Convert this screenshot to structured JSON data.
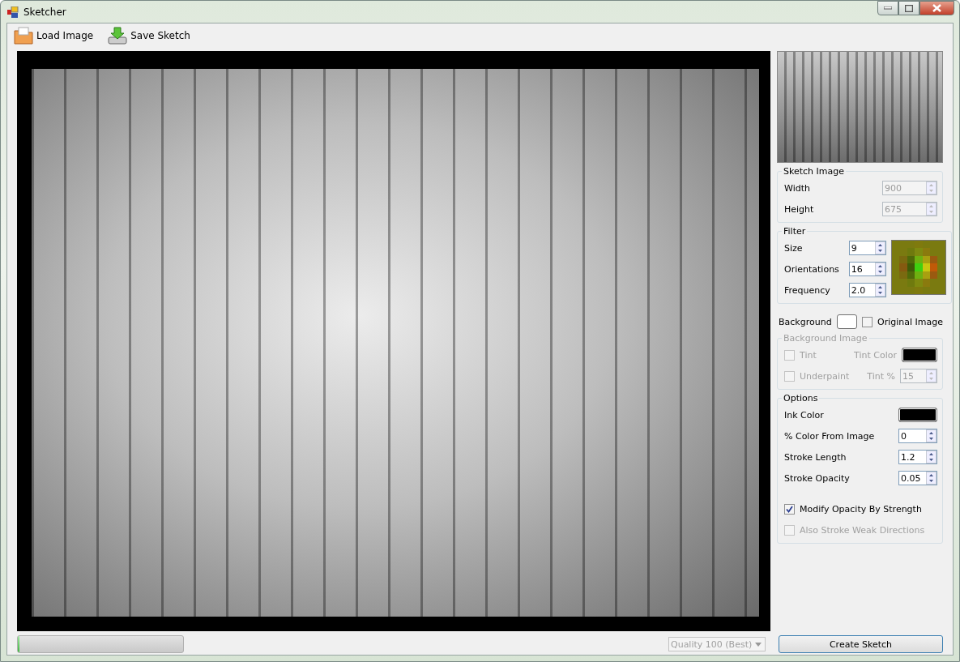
{
  "window": {
    "title": "Sketcher"
  },
  "toolbar": [
    {
      "label": "Load Image",
      "kind": "folder"
    },
    {
      "label": "Save Sketch",
      "kind": "save"
    }
  ],
  "sketch_image": {
    "title": "Sketch Image",
    "fields": [
      {
        "label": "Width",
        "value": "900",
        "disabled": true
      },
      {
        "label": "Height",
        "value": "675",
        "disabled": true
      }
    ]
  },
  "filter": {
    "title": "Filter",
    "fields": [
      {
        "label": "Size",
        "value": "9",
        "disabled": false
      },
      {
        "label": "Orientations",
        "value": "16",
        "disabled": false
      },
      {
        "label": "Frequency",
        "value": "2.0",
        "disabled": false
      }
    ]
  },
  "background": {
    "label": "Background",
    "color": "#ffffff",
    "original_image": {
      "label": "Original Image",
      "checked": false
    }
  },
  "background_image": {
    "title": "Background Image",
    "disabled": true,
    "tint": {
      "label": "Tint",
      "checked": false
    },
    "tint_color": {
      "label": "Tint Color",
      "color": "#000000"
    },
    "underpaint": {
      "label": "Underpaint",
      "checked": false
    },
    "tint_percent": {
      "label": "Tint %",
      "value": "15"
    }
  },
  "options": {
    "title": "Options",
    "ink_color": {
      "label": "Ink Color",
      "color": "#000000"
    },
    "fields": [
      {
        "label": "% Color From Image",
        "value": "0"
      },
      {
        "label": "Stroke Length",
        "value": "1.2"
      },
      {
        "label": "Stroke Opacity",
        "value": "0.05"
      }
    ],
    "checks": [
      {
        "label": "Modify Opacity By Strength",
        "checked": true,
        "disabled": false
      },
      {
        "label": "Also Stroke Weak Directions",
        "checked": false,
        "disabled": true
      }
    ]
  },
  "status": {
    "progress": {
      "level": 0
    },
    "quality": {
      "value": "Quality 100 (Best)",
      "disabled": true
    },
    "button": "Create Sketch"
  }
}
